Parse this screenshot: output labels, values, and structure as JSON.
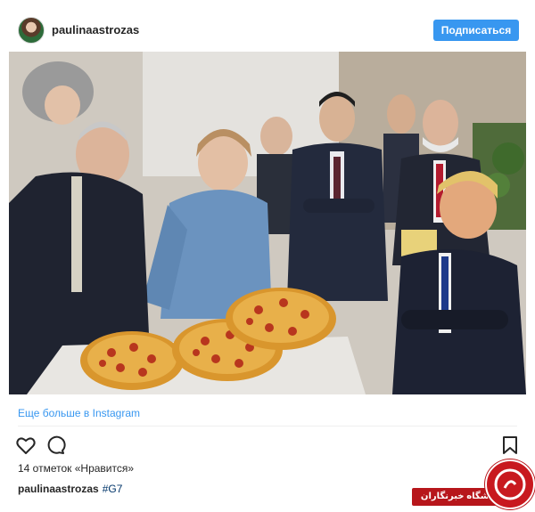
{
  "post": {
    "username": "paulinaastrozas",
    "follow_label": "Подписаться",
    "more_link": "Еще больше в Instagram",
    "likes": "14 отметок «Нравится»",
    "caption_user": "paulinaastrozas",
    "caption_tag": "#G7"
  },
  "icons": [
    "heart-icon",
    "comment-icon",
    "bookmark-icon"
  ],
  "colors": {
    "accent": "#3897f0",
    "watermark": "#c8191f"
  },
  "watermark": {
    "text": "باشگاه خبرنگاران"
  }
}
